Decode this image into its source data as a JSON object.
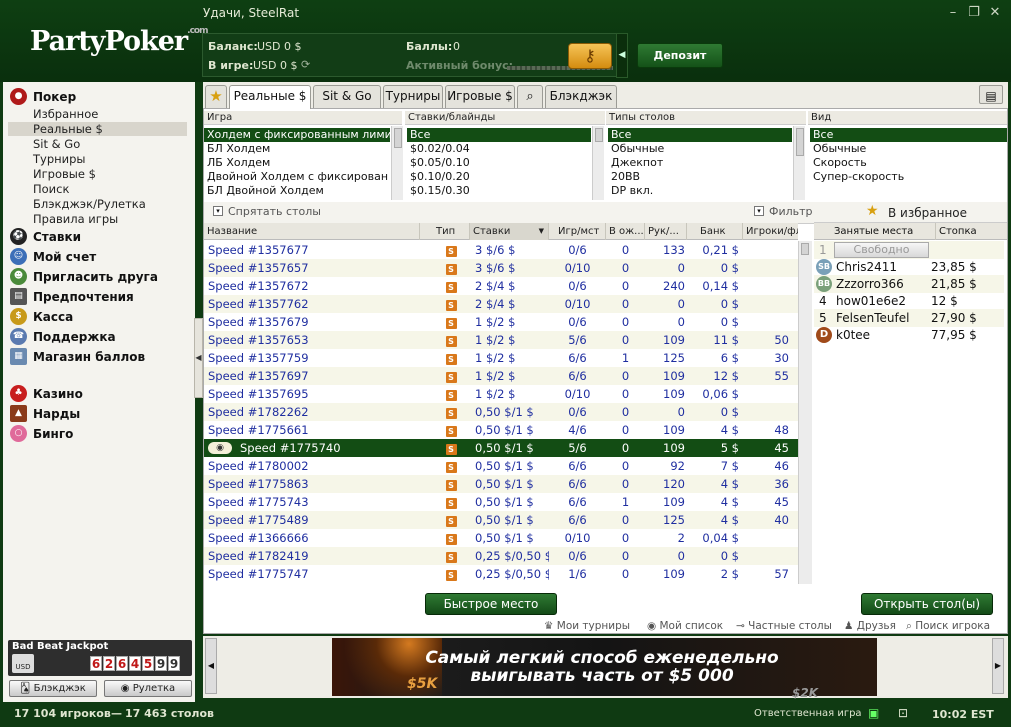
{
  "header": {
    "greeting": "Удачи, SteelRat",
    "logo_text": "PartyPoker",
    "logo_suffix": ".com",
    "balance_label": "Баланс:",
    "balance_value": "USD 0 $",
    "ingame_label": "В игре:",
    "ingame_value": "USD 0 $",
    "points_label": "Баллы:",
    "points_value": "0",
    "bonus_label": "Активный бонус:",
    "deposit_label": "Депозит"
  },
  "sidebar": {
    "poker": "Покер",
    "poker_items": [
      "Избранное",
      "Реальные $",
      "Sit & Go",
      "Турниры",
      "Игровые $",
      "Поиск",
      "Блэкджэк/Рулетка",
      "Правила игры"
    ],
    "bets": "Ставки",
    "account": "Мой счет",
    "invite": "Пригласить друга",
    "prefs": "Предпочтения",
    "cashier": "Касса",
    "support": "Поддержка",
    "shop": "Магазин баллов",
    "casino": "Казино",
    "backgammon": "Нарды",
    "bingo": "Бинго",
    "jackpot_label": "Bad Beat Jackpot",
    "jackpot_currency": "USD",
    "jackpot_digits": [
      "6",
      "2",
      "6",
      "4",
      "5",
      "9",
      "9"
    ],
    "blackjack_btn": "Блэкджэк",
    "roulette_btn": "Рулетка"
  },
  "tabs": [
    "Реальные $",
    "Sit & Go",
    "Турниры",
    "Игровые $",
    "Блэкджэк"
  ],
  "filters": {
    "game_header": "Игра",
    "game_items": [
      "Холдем с фиксированным лими",
      "БЛ Холдем",
      "ЛБ Холдем",
      "Двойной Холдем с фиксирован",
      "БЛ Двойной Холдем"
    ],
    "stakes_header": "Ставки/блайнды",
    "stakes_items": [
      "Все",
      "$0.02/0.04",
      "$0.05/0.10",
      "$0.10/0.20",
      "$0.15/0.30"
    ],
    "types_header": "Типы столов",
    "types_items": [
      "Все",
      "Обычные",
      "Джекпот",
      "20BB",
      "DP вкл."
    ],
    "view_header": "Вид",
    "view_items": [
      "Все",
      "Обычные",
      "Скорость",
      "Супер-скорость"
    ]
  },
  "toolbar": {
    "hide_tables": "Спрятать столы",
    "filter": "Фильтр",
    "favorites": "В избранное"
  },
  "table": {
    "columns": [
      "Название",
      "Тип",
      "Ставки",
      "Игр/мст",
      "В ож...",
      "Рук/...",
      "Банк",
      "Игроки/фл"
    ],
    "rows": [
      {
        "name": "Speed #1357677",
        "type": "S",
        "stakes": "3 $/6 $",
        "players": "0/6",
        "waiting": "0",
        "hands": "133",
        "pot": "0,21 $",
        "flop": ""
      },
      {
        "name": "Speed #1357657",
        "type": "S",
        "stakes": "3 $/6 $",
        "players": "0/10",
        "waiting": "0",
        "hands": "0",
        "pot": "0 $",
        "flop": ""
      },
      {
        "name": "Speed #1357672",
        "type": "S",
        "stakes": "2 $/4 $",
        "players": "0/6",
        "waiting": "0",
        "hands": "240",
        "pot": "0,14 $",
        "flop": ""
      },
      {
        "name": "Speed #1357762",
        "type": "S",
        "stakes": "2 $/4 $",
        "players": "0/10",
        "waiting": "0",
        "hands": "0",
        "pot": "0 $",
        "flop": ""
      },
      {
        "name": "Speed #1357679",
        "type": "S",
        "stakes": "1 $/2 $",
        "players": "0/6",
        "waiting": "0",
        "hands": "0",
        "pot": "0 $",
        "flop": ""
      },
      {
        "name": "Speed #1357653",
        "type": "S",
        "stakes": "1 $/2 $",
        "players": "5/6",
        "waiting": "0",
        "hands": "109",
        "pot": "11 $",
        "flop": "50"
      },
      {
        "name": "Speed #1357759",
        "type": "S",
        "stakes": "1 $/2 $",
        "players": "6/6",
        "waiting": "1",
        "hands": "125",
        "pot": "6 $",
        "flop": "30"
      },
      {
        "name": "Speed #1357697",
        "type": "S",
        "stakes": "1 $/2 $",
        "players": "6/6",
        "waiting": "0",
        "hands": "109",
        "pot": "12 $",
        "flop": "55"
      },
      {
        "name": "Speed #1357695",
        "type": "S",
        "stakes": "1 $/2 $",
        "players": "0/10",
        "waiting": "0",
        "hands": "109",
        "pot": "0,06 $",
        "flop": ""
      },
      {
        "name": "Speed #1782262",
        "type": "S",
        "stakes": "0,50 $/1 $",
        "players": "0/6",
        "waiting": "0",
        "hands": "0",
        "pot": "0 $",
        "flop": ""
      },
      {
        "name": "Speed #1775661",
        "type": "S",
        "stakes": "0,50 $/1 $",
        "players": "4/6",
        "waiting": "0",
        "hands": "109",
        "pot": "4 $",
        "flop": "48"
      },
      {
        "name": "Speed #1775740",
        "type": "S",
        "stakes": "0,50 $/1 $",
        "players": "5/6",
        "waiting": "0",
        "hands": "109",
        "pot": "5 $",
        "flop": "45"
      },
      {
        "name": "Speed #1780002",
        "type": "S",
        "stakes": "0,50 $/1 $",
        "players": "6/6",
        "waiting": "0",
        "hands": "92",
        "pot": "7 $",
        "flop": "46"
      },
      {
        "name": "Speed #1775863",
        "type": "S",
        "stakes": "0,50 $/1 $",
        "players": "6/6",
        "waiting": "0",
        "hands": "120",
        "pot": "4 $",
        "flop": "36"
      },
      {
        "name": "Speed #1775743",
        "type": "S",
        "stakes": "0,50 $/1 $",
        "players": "6/6",
        "waiting": "1",
        "hands": "109",
        "pot": "4 $",
        "flop": "45"
      },
      {
        "name": "Speed #1775489",
        "type": "S",
        "stakes": "0,50 $/1 $",
        "players": "6/6",
        "waiting": "0",
        "hands": "125",
        "pot": "4 $",
        "flop": "40"
      },
      {
        "name": "Speed #1366666",
        "type": "S",
        "stakes": "0,50 $/1 $",
        "players": "0/10",
        "waiting": "0",
        "hands": "2",
        "pot": "0,04 $",
        "flop": ""
      },
      {
        "name": "Speed #1782419",
        "type": "S",
        "stakes": "0,25 $/0,50 $",
        "players": "0/6",
        "waiting": "0",
        "hands": "0",
        "pot": "0 $",
        "flop": ""
      },
      {
        "name": "Speed #1775747",
        "type": "S",
        "stakes": "0,25 $/0,50 $",
        "players": "1/6",
        "waiting": "0",
        "hands": "109",
        "pot": "2 $",
        "flop": "57"
      }
    ]
  },
  "seats": {
    "header_name": "Занятые места",
    "header_stack": "Стопка",
    "free_label": "Свободно",
    "rows": [
      {
        "num": "1",
        "name": "",
        "stack": ""
      },
      {
        "num": "SB",
        "name": "Chris2411",
        "stack": "23,85 $"
      },
      {
        "num": "BB",
        "name": "Zzzorro366",
        "stack": "21,85 $"
      },
      {
        "num": "4",
        "name": "how01e6e2",
        "stack": "12 $"
      },
      {
        "num": "5",
        "name": "FelsenTeufel",
        "stack": "27,90 $"
      },
      {
        "num": "D",
        "name": "k0tee",
        "stack": "77,95 $"
      }
    ]
  },
  "actions": {
    "quick_seat": "Быстрое место",
    "open_tables": "Открыть стол(ы)"
  },
  "links": [
    "Мои турниры",
    "Мой список",
    "Частные столы",
    "Друзья",
    "Поиск игрока"
  ],
  "banner": {
    "line1": "Самый легкий способ еженедельно",
    "line2": "выигывать часть от $5 000",
    "badge_left": "$5K",
    "badge_right": "$2K"
  },
  "status": {
    "players": "17 104 игроков",
    "tables": "17 463 столов",
    "responsible": "Ответственная игра",
    "time": "10:02 EST"
  },
  "colors": {
    "brand_green": "#134d14",
    "link_blue": "#1f2ea0",
    "jackpot_red": "#c01818"
  }
}
